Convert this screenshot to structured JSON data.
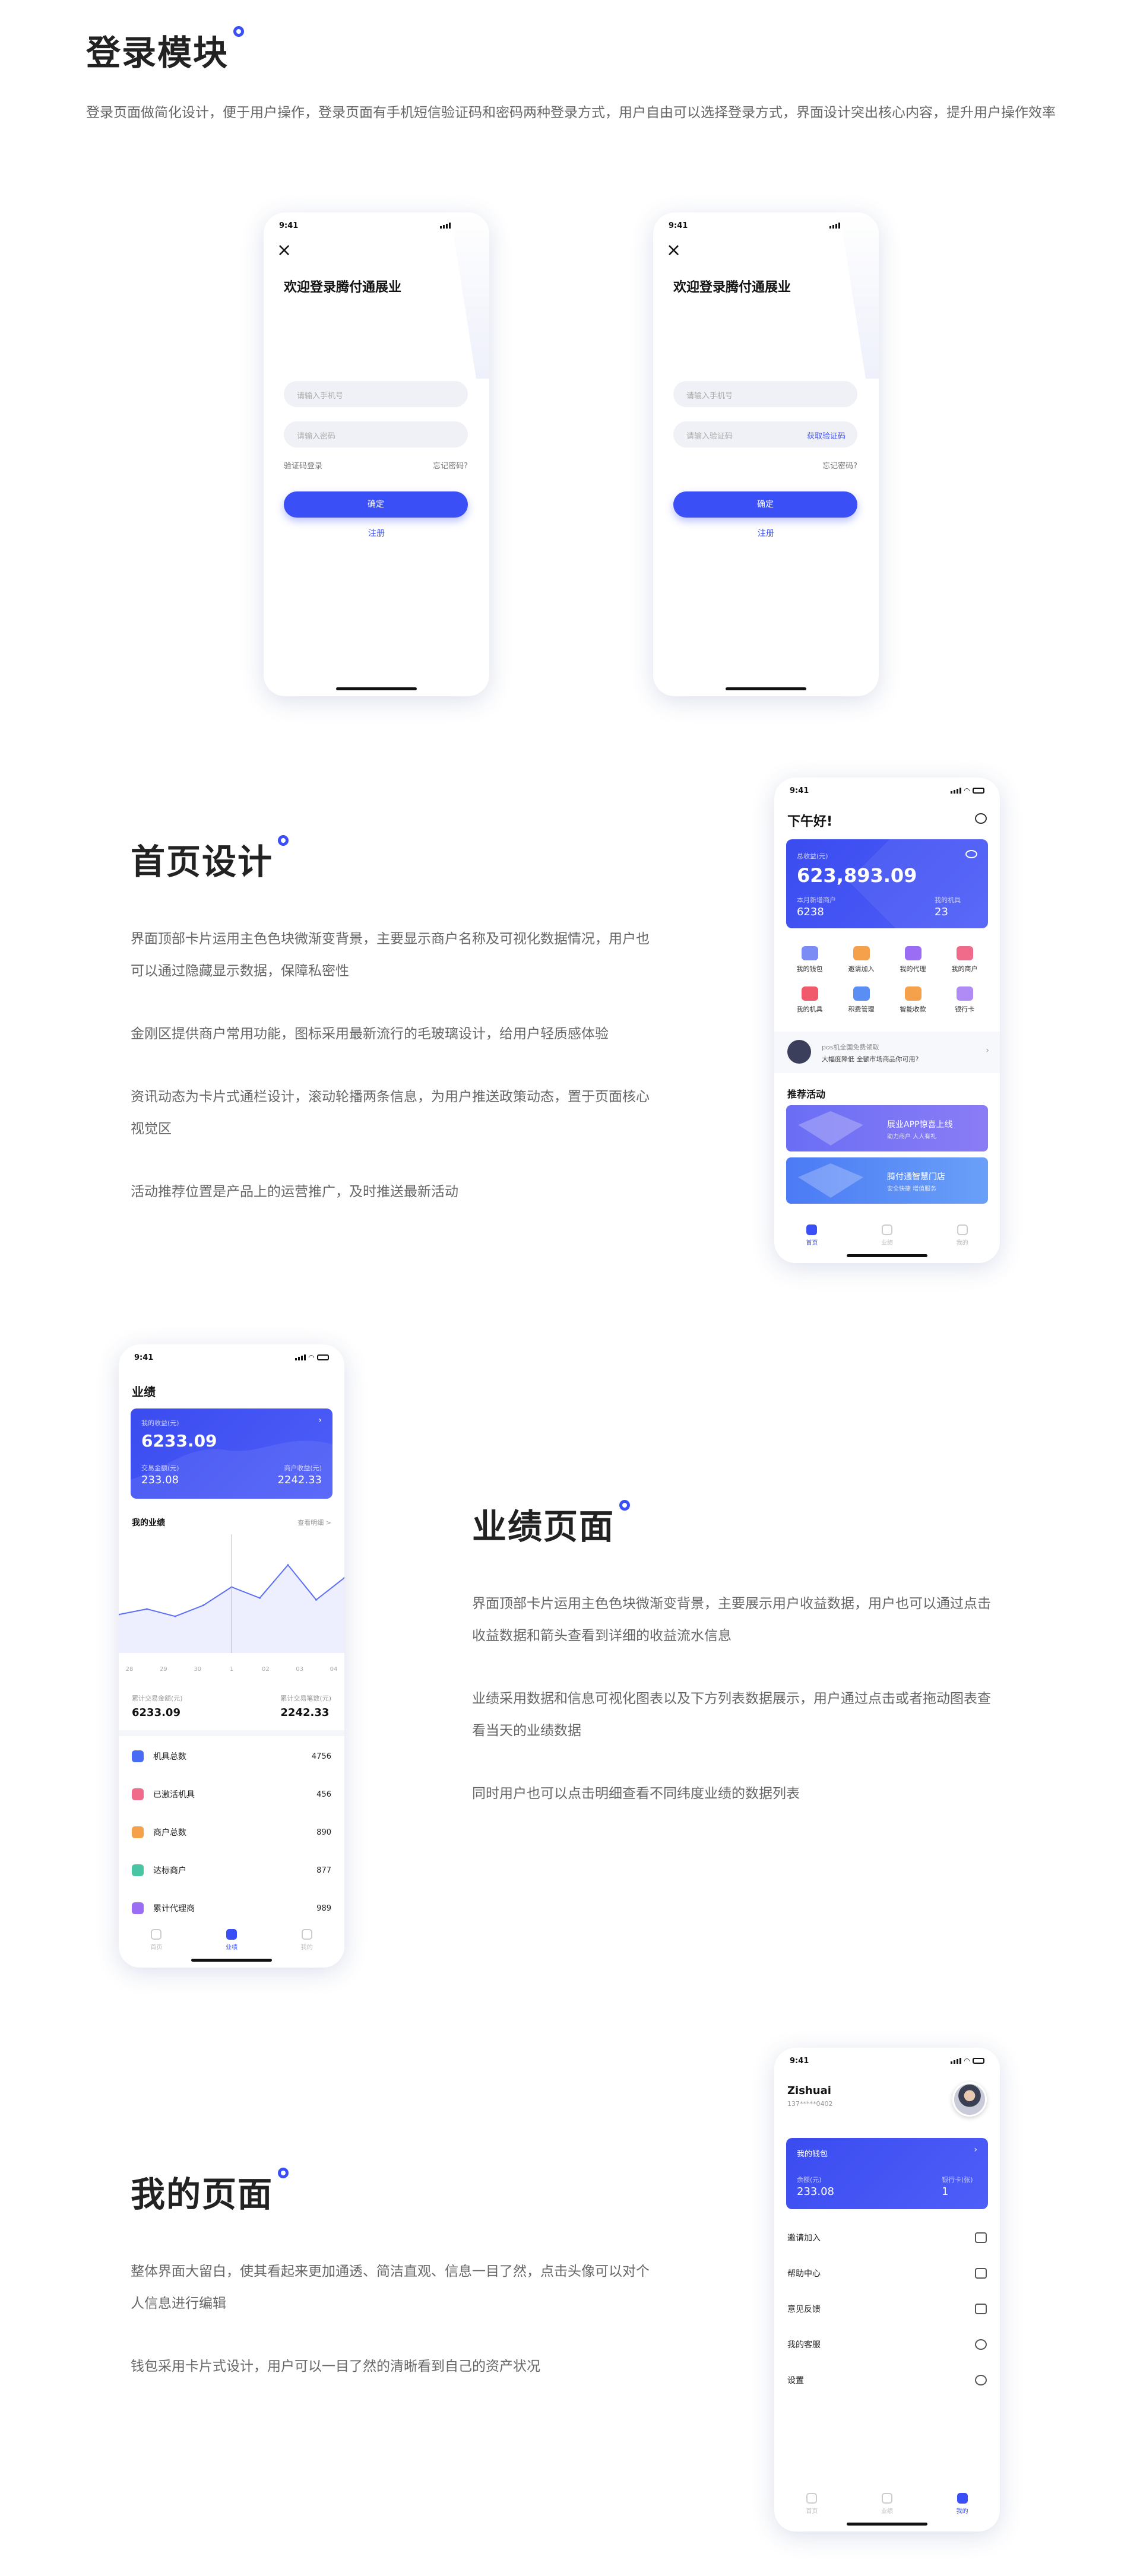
{
  "sections": {
    "login": {
      "title": "登录模块",
      "desc": "登录页面做简化设计，便于用户操作，登录页面有手机短信验证码和密码两种登录方式，用户自由可以选择登录方式，界面设计突出核心内容，提升用户操作效率"
    },
    "home": {
      "title": "首页设计",
      "paras": [
        "界面顶部卡片运用主色色块微渐变背景，主要显示商户名称及可视化数据情况，用户也可以通过隐藏显示数据，保障私密性",
        "金刚区提供商户常用功能，图标采用最新流行的毛玻璃设计，给用户轻质感体验",
        "资讯动态为卡片式通栏设计，滚动轮播两条信息，为用户推送政策动态，置于页面核心视觉区",
        "活动推荐位置是产品上的运营推广，及时推送最新活动"
      ]
    },
    "perf": {
      "title": "业绩页面",
      "paras": [
        "界面顶部卡片运用主色色块微渐变背景，主要展示用户收益数据，用户也可以通过点击收益数据和箭头查看到详细的收益流水信息",
        "业绩采用数据和信息可视化图表以及下方列表数据展示，用户通过点击或者拖动图表查看当天的业绩数据",
        "同时用户也可以点击明细查看不同纬度业绩的数据列表"
      ]
    },
    "mine": {
      "title": "我的页面",
      "paras": [
        "整体界面大留白，使其看起来更加通透、简洁直观、信息一目了然，点击头像可以对个人信息进行编辑",
        "钱包采用卡片式设计，用户可以一目了然的清晰看到自己的资产状况"
      ]
    }
  },
  "status_time": "9:41",
  "login1": {
    "welcome": "欢迎登录腾付通展业",
    "phone_ph": "请输入手机号",
    "pwd_ph": "请输入密码",
    "code_login": "验证码登录",
    "forgot": "忘记密码?",
    "confirm": "确定",
    "register": "注册"
  },
  "login2": {
    "welcome": "欢迎登录腾付通展业",
    "phone_ph": "请输入手机号",
    "code_ph": "请输入验证码",
    "get_code": "获取验证码",
    "forgot": "忘记密码?",
    "confirm": "确定",
    "register": "注册"
  },
  "home": {
    "greeting": "下午好!",
    "card_label": "总收益(元)",
    "amount": "623,893.09",
    "left_label": "本月新增商户",
    "left_value": "6238",
    "right_label": "我的机具",
    "right_value": "23",
    "icons": [
      {
        "label": "我的钱包",
        "color": "#7b8cf5"
      },
      {
        "label": "邀请加入",
        "color": "#f5a14b"
      },
      {
        "label": "我的代理",
        "color": "#9b6df5"
      },
      {
        "label": "我的商户",
        "color": "#f06a8a"
      },
      {
        "label": "我的机具",
        "color": "#f05a6a"
      },
      {
        "label": "积费管理",
        "color": "#5a8ef5"
      },
      {
        "label": "智能收款",
        "color": "#f5a14b"
      },
      {
        "label": "银行卡",
        "color": "#b08af5"
      }
    ],
    "news1": "pos机全国免费领取",
    "news2": "大幅度降低 全额市场商品你可用?",
    "rec_title": "推荐活动",
    "banner1_title": "展业APP惊喜上线",
    "banner1_sub": "助力商户 人人有礼",
    "banner2_title": "腾付通智慧门店",
    "banner2_sub": "安全快捷 增值服务",
    "tabs": [
      "首页",
      "业绩",
      "我的"
    ]
  },
  "perf": {
    "title": "业绩",
    "card_label": "我的收益(元)",
    "amount": "6233.09",
    "left_label": "交易金额(元)",
    "left_value": "233.08",
    "right_label": "商户收益(元)",
    "right_value": "2242.33",
    "my_perf": "我的业绩",
    "detail": "查看明细 >",
    "chart_data": {
      "type": "line",
      "x": [
        "28",
        "29",
        "30",
        "1",
        "02",
        "03",
        "04"
      ],
      "values": [
        2.1,
        2.4,
        2.0,
        2.6,
        3.6,
        3.0,
        4.8,
        2.9,
        4.1
      ]
    },
    "sum1_label": "累计交易金额(元)",
    "sum1_value": "6233.09",
    "sum2_label": "累计交易笔数(元)",
    "sum2_value": "2242.33",
    "list": [
      {
        "label": "机具总数",
        "value": "4756",
        "color": "#4a6cf5"
      },
      {
        "label": "已激活机具",
        "value": "456",
        "color": "#f06a8a"
      },
      {
        "label": "商户总数",
        "value": "890",
        "color": "#f5a14b"
      },
      {
        "label": "达标商户",
        "value": "877",
        "color": "#4ac5a4"
      },
      {
        "label": "累计代理商",
        "value": "989",
        "color": "#9b6df5"
      }
    ],
    "tabs": [
      "首页",
      "业绩",
      "我的"
    ]
  },
  "mine": {
    "name": "Zishuai",
    "phone": "137*****0402",
    "wallet": "我的钱包",
    "left_label": "余额(元)",
    "left_value": "233.08",
    "right_label": "银行卡(张)",
    "right_value": "1",
    "items": [
      "邀请加入",
      "帮助中心",
      "意见反馈",
      "我的客服",
      "设置"
    ],
    "tabs": [
      "首页",
      "业绩",
      "我的"
    ]
  }
}
